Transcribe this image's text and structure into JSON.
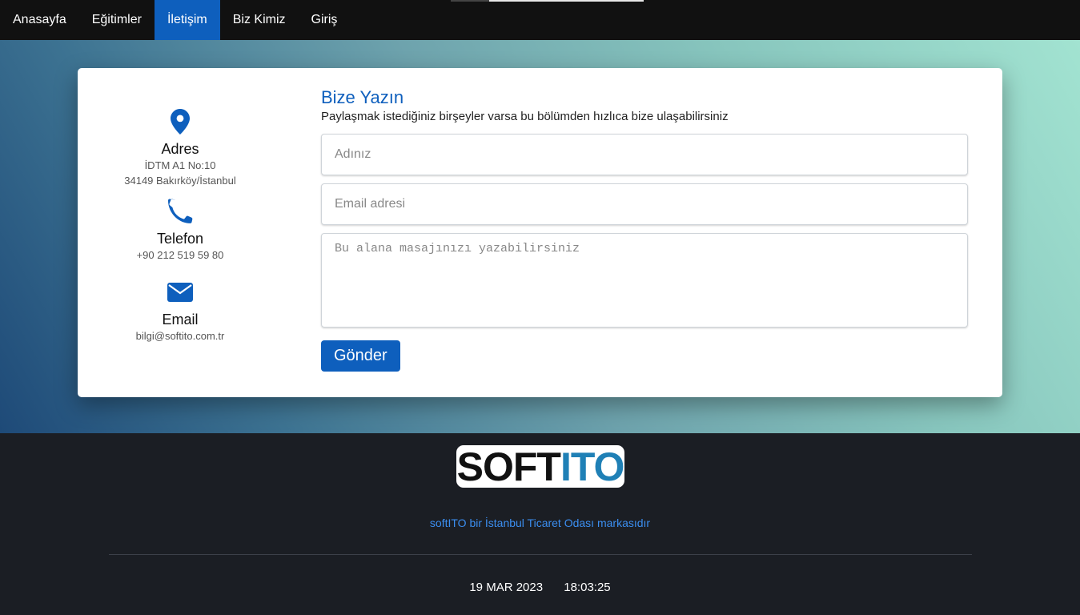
{
  "nav": {
    "items": [
      {
        "label": "Anasayfa",
        "active": false
      },
      {
        "label": "Eğitimler",
        "active": false
      },
      {
        "label": "İletişim",
        "active": true
      },
      {
        "label": "Biz Kimiz",
        "active": false
      },
      {
        "label": "Giriş",
        "active": false
      }
    ]
  },
  "contact": {
    "address": {
      "icon": "location-pin-icon",
      "title": "Adres",
      "line1": "İDTM A1 No:10",
      "line2": "34149 Bakırköy/İstanbul"
    },
    "phone": {
      "icon": "phone-icon",
      "title": "Telefon",
      "value": "+90 212 519 59 80"
    },
    "email": {
      "icon": "envelope-icon",
      "title": "Email",
      "value": "bilgi@softito.com.tr"
    }
  },
  "form": {
    "title": "Bize Yazın",
    "subtitle": "Paylaşmak istediğiniz birşeyler varsa bu bölümden hızlıca bize ulaşabilirsiniz",
    "name_placeholder": "Adınız",
    "email_placeholder": "Email adresi",
    "message_placeholder": "Bu alana masajınızı yazabilirsiniz",
    "submit_label": "Gönder"
  },
  "footer": {
    "logo": {
      "part1": "SOFT",
      "part2": "ITO"
    },
    "note": "softITO bir İstanbul Ticaret Odası markasıdır",
    "date": "19 MAR 2023",
    "time": "18:03:25"
  },
  "colors": {
    "accent": "#0e5fbd",
    "navbar_bg": "#111111",
    "footer_bg": "#1b1e24",
    "link_blue": "#3b8ef0",
    "logo_ito": "#1f80b6"
  }
}
